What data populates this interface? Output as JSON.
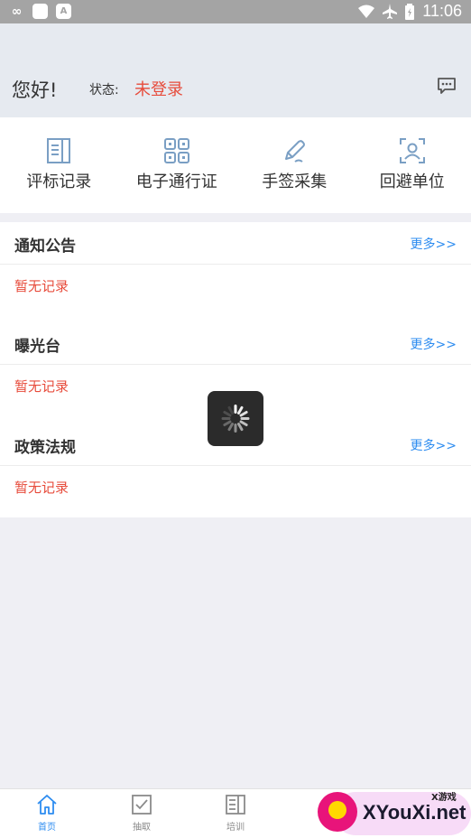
{
  "status_bar": {
    "time": "11:06",
    "left_icons": [
      "infinity-icon",
      "square-icon",
      "a-icon"
    ],
    "right_icons": [
      "wifi-icon",
      "airplane-icon",
      "battery-icon"
    ]
  },
  "header": {
    "greeting": "您好!",
    "status_label": "状态:",
    "status_value": "未登录",
    "message_icon": "chat-bubble-icon"
  },
  "quick_menu": [
    {
      "label": "评标记录",
      "icon": "record-book-icon"
    },
    {
      "label": "电子通行证",
      "icon": "qr-code-icon"
    },
    {
      "label": "手签采集",
      "icon": "pen-icon"
    },
    {
      "label": "回避单位",
      "icon": "person-frame-icon"
    }
  ],
  "sections": [
    {
      "title": "通知公告",
      "more": "更多>>",
      "empty": "暂无记录"
    },
    {
      "title": "曝光台",
      "more": "更多>>",
      "empty": "暂无记录"
    },
    {
      "title": "政策法规",
      "more": "更多>>",
      "empty": "暂无记录"
    }
  ],
  "loading_icon": "spinner-icon",
  "tabbar": [
    {
      "label": "首页",
      "icon": "home-icon",
      "active": true
    },
    {
      "label": "抽取",
      "icon": "checkbox-icon",
      "active": false
    },
    {
      "label": "培训",
      "icon": "book-icon",
      "active": false
    }
  ],
  "watermark": {
    "small_text": "X游戏",
    "text": "XYouXi.net"
  },
  "colors": {
    "accent": "#2d8cf0",
    "warning": "#e74c3c",
    "header_bg": "#e6eaf0",
    "icon_blue": "#7a9fc4"
  }
}
